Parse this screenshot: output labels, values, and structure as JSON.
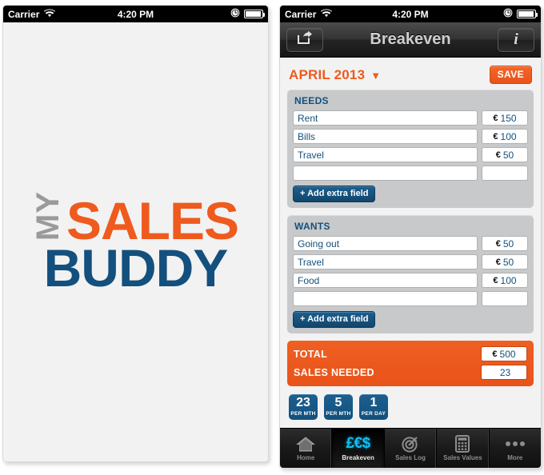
{
  "status_bar": {
    "carrier": "Carrier",
    "time": "4:20 PM",
    "wifi_icon": "wifi-icon",
    "clock_icon": "clock-icon",
    "battery_icon": "battery-icon"
  },
  "left_screen": {
    "logo": {
      "word_my": "MY",
      "word_sales": "SALES",
      "word_buddy": "BUDDY",
      "color_my": "#9a9a9a",
      "color_sales": "#ef5a1e",
      "color_buddy": "#13507d"
    },
    "background": "#f2f2f2"
  },
  "right_screen": {
    "navbar": {
      "title": "Breakeven",
      "share_icon": "share-icon",
      "info_icon": "info-icon"
    },
    "month_selector": {
      "label": "APRIL 2013",
      "caret": "▼"
    },
    "save_button": {
      "label": "SAVE",
      "color": "#ef5a1e"
    },
    "panels": [
      {
        "title": "NEEDS",
        "rows": [
          {
            "name": "Rent",
            "currency": "€",
            "amount": "150"
          },
          {
            "name": "Bills",
            "currency": "€",
            "amount": "100"
          },
          {
            "name": "Travel",
            "currency": "€",
            "amount": "50"
          },
          {
            "name": "",
            "currency": "",
            "amount": ""
          }
        ],
        "add_label": "+ Add extra field"
      },
      {
        "title": "WANTS",
        "rows": [
          {
            "name": "Going out",
            "currency": "€",
            "amount": "50"
          },
          {
            "name": "Travel",
            "currency": "€",
            "amount": "50"
          },
          {
            "name": "Food",
            "currency": "€",
            "amount": "100"
          },
          {
            "name": "",
            "currency": "",
            "amount": ""
          }
        ],
        "add_label": "+ Add extra field"
      }
    ],
    "totals": {
      "background": "#ef5a1e",
      "rows": [
        {
          "label": "TOTAL",
          "currency": "€",
          "value": "500"
        },
        {
          "label": "SALES NEEDED",
          "currency": "",
          "value": "23"
        }
      ]
    },
    "badges": [
      {
        "number": "23",
        "caption": "PER MTH"
      },
      {
        "number": "5",
        "caption": "PER MTH"
      },
      {
        "number": "1",
        "caption": "PER DAY"
      }
    ],
    "tabbar": {
      "active_index": 1,
      "tabs": [
        {
          "label": "Home",
          "icon": "home-icon"
        },
        {
          "label": "Breakeven",
          "icon": "currency-icon",
          "glyph": "£€$"
        },
        {
          "label": "Sales Log",
          "icon": "target-icon"
        },
        {
          "label": "Sales Values",
          "icon": "calculator-icon"
        },
        {
          "label": "More",
          "icon": "ellipsis-icon"
        }
      ]
    }
  }
}
